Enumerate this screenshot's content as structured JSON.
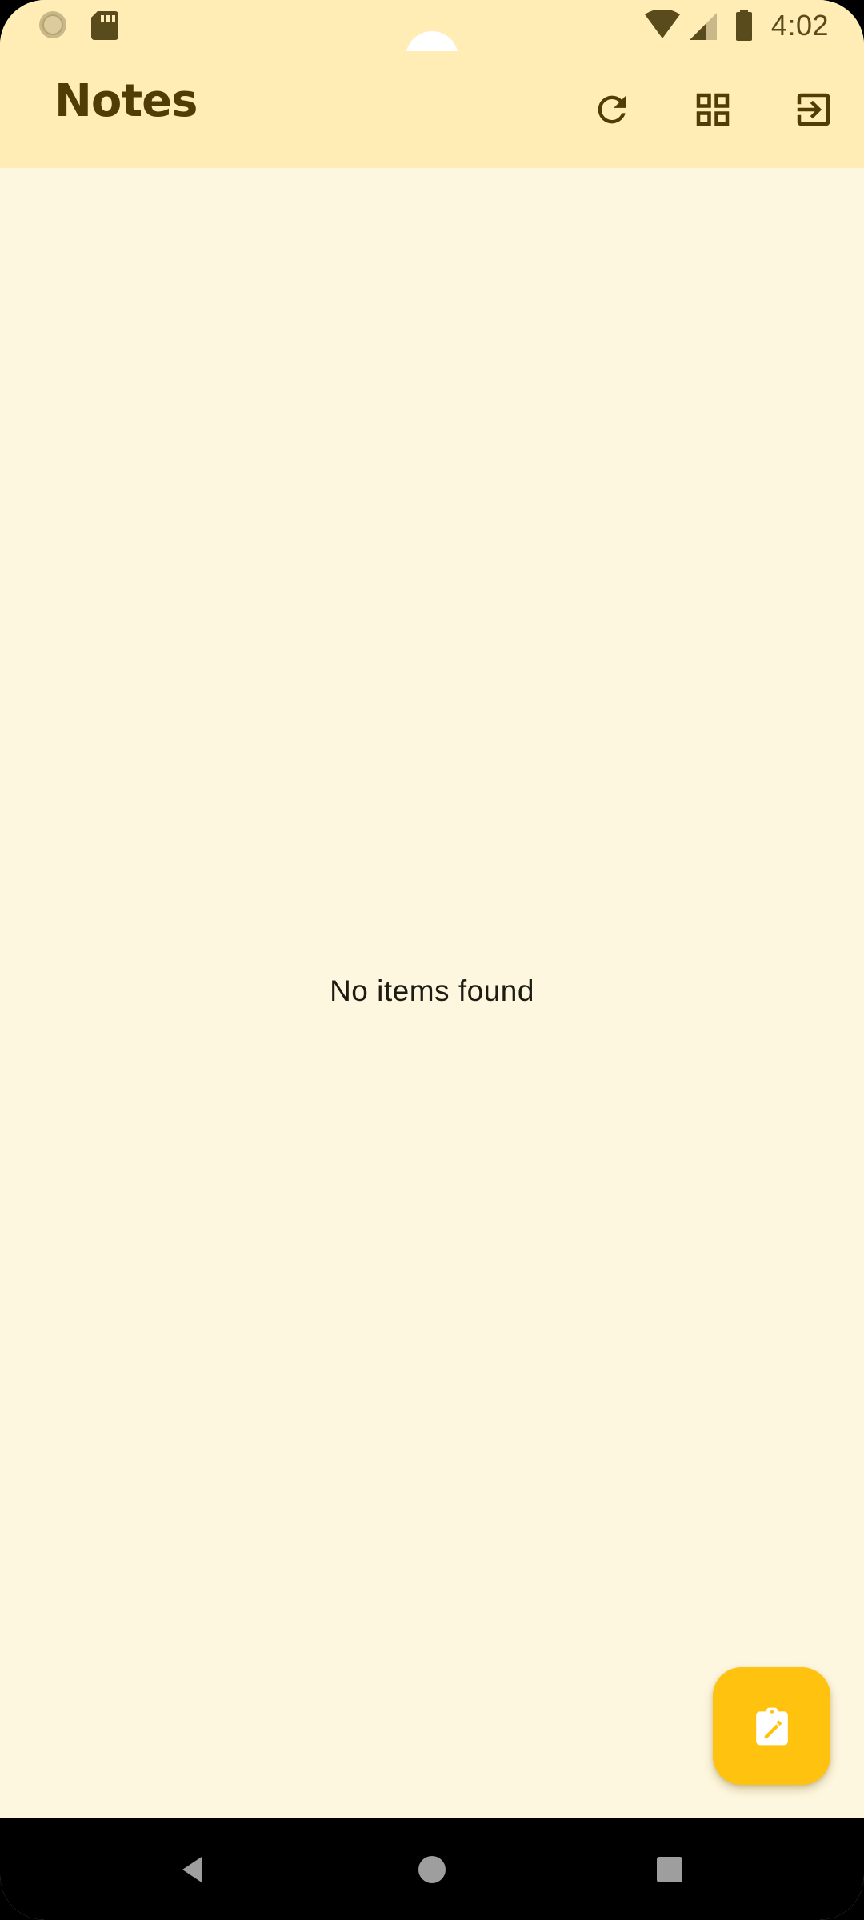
{
  "status_bar": {
    "time": "4:02",
    "left_icons": [
      "sync-notification-icon",
      "sd-card-icon"
    ],
    "right_icons": [
      "wifi-icon",
      "cell-signal-icon",
      "battery-icon"
    ]
  },
  "app_bar": {
    "title": "Notes",
    "actions": [
      {
        "name": "refresh-button",
        "icon": "refresh-icon"
      },
      {
        "name": "grid-view-button",
        "icon": "grid-view-icon"
      },
      {
        "name": "logout-button",
        "icon": "logout-icon"
      }
    ]
  },
  "main": {
    "empty_message": "No items found"
  },
  "fab": {
    "icon": "edit-note-icon"
  },
  "nav_bar": {
    "buttons": [
      "back-icon",
      "home-icon",
      "recents-icon"
    ]
  },
  "colors": {
    "app_bar_bg": "#FFEDB5",
    "content_bg": "#FEF7DF",
    "accent": "#FFC20E",
    "title_text": "#4E3D06",
    "icon_color": "#5A4B1C"
  }
}
